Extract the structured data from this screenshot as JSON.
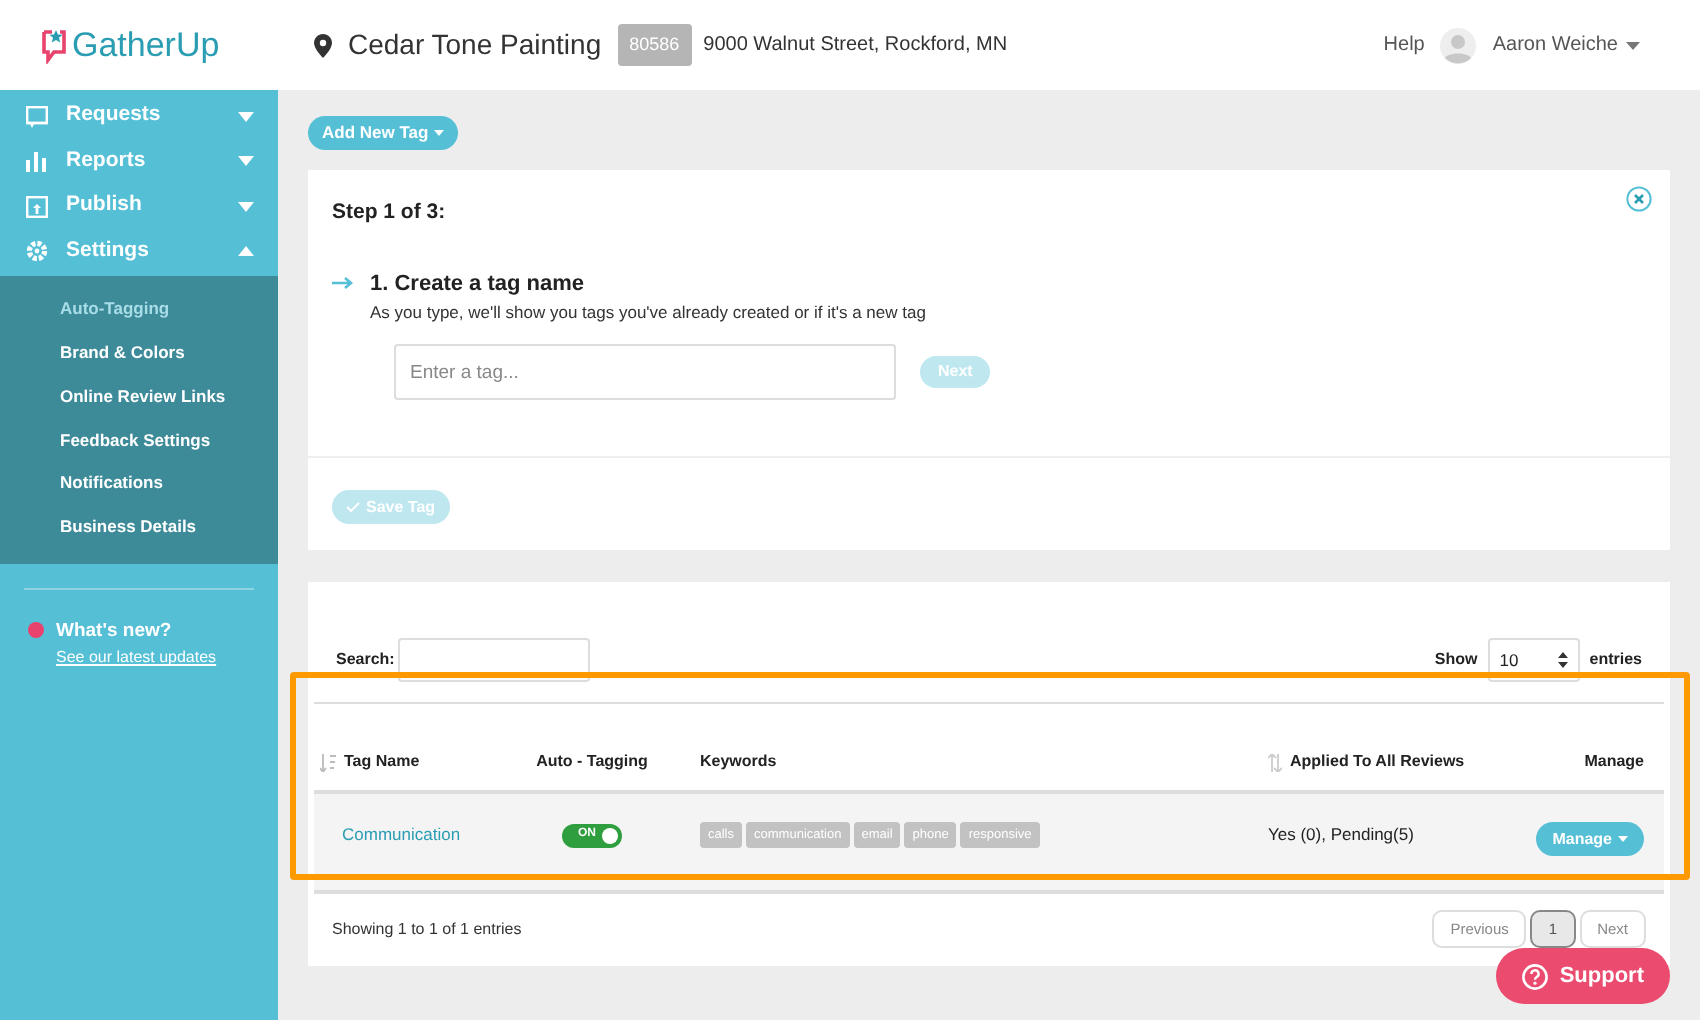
{
  "logo": {
    "text": "GatherUp"
  },
  "header": {
    "location": "Cedar Tone Painting",
    "location_id": "80586",
    "address": "9000 Walnut Street, Rockford, MN",
    "help": "Help",
    "user": "Aaron Weiche"
  },
  "sidebar": {
    "items": [
      {
        "label": "Requests",
        "expanded": false
      },
      {
        "label": "Reports",
        "expanded": false
      },
      {
        "label": "Publish",
        "expanded": false
      },
      {
        "label": "Settings",
        "expanded": true,
        "children": [
          {
            "label": "Auto-Tagging",
            "selected": true
          },
          {
            "label": "Brand & Colors",
            "selected": false
          },
          {
            "label": "Online Review Links",
            "selected": false
          },
          {
            "label": "Feedback Settings",
            "selected": false
          },
          {
            "label": "Notifications",
            "selected": false
          },
          {
            "label": "Business Details",
            "selected": false
          }
        ]
      }
    ],
    "whats_new": {
      "title": "What's new?",
      "link": "See our latest updates"
    }
  },
  "add_button": "Add New Tag",
  "step": {
    "title": "Step 1 of 3:",
    "heading": "1. Create a tag name",
    "hint": "As you type, we'll show you tags you've already created or if it's a new tag",
    "placeholder": "Enter a tag...",
    "next": "Next",
    "save": "Save Tag"
  },
  "table": {
    "search_label": "Search:",
    "show_label": "Show",
    "page_size": "10",
    "entries_label": "entries",
    "columns": [
      "Tag Name",
      "Auto - Tagging",
      "Keywords",
      "Applied To All Reviews",
      "Manage"
    ],
    "rows": [
      {
        "tag": "Communication",
        "auto_tagging": true,
        "toggle_label": "ON",
        "keywords": [
          "calls",
          "communication",
          "email",
          "phone",
          "responsive"
        ],
        "applied": "Yes (0), Pending(5)",
        "manage": "Manage"
      }
    ],
    "summary": "Showing 1 to 1 of 1 entries",
    "pagination": [
      {
        "label": "Previous",
        "selected": false
      },
      {
        "label": "1",
        "selected": true
      },
      {
        "label": "Next",
        "selected": false
      }
    ]
  },
  "support": "Support"
}
